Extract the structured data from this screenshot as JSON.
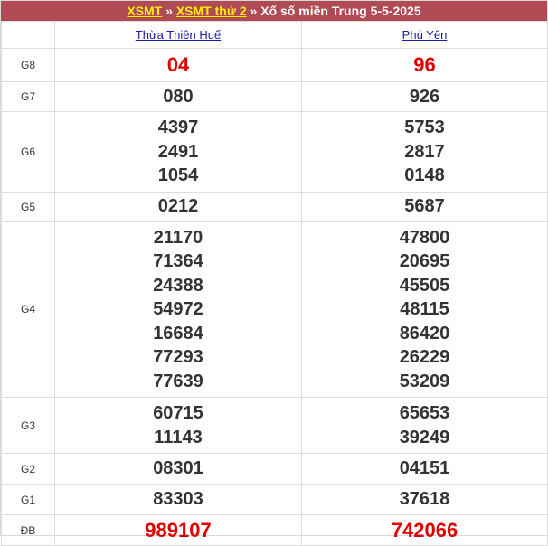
{
  "header": {
    "link1": "XSMT",
    "sep1": "»",
    "link2": "XSMT thứ 2",
    "sep2": "»",
    "title": "Xổ số miền Trung 5-5-2025"
  },
  "provinces": [
    "Thừa Thiên Huế",
    "Phú Yên"
  ],
  "prizes": [
    {
      "label": "G8",
      "p1": [
        "04"
      ],
      "p2": [
        "96"
      ]
    },
    {
      "label": "G7",
      "p1": [
        "080"
      ],
      "p2": [
        "926"
      ]
    },
    {
      "label": "G6",
      "p1": [
        "4397",
        "2491",
        "1054"
      ],
      "p2": [
        "5753",
        "2817",
        "0148"
      ]
    },
    {
      "label": "G5",
      "p1": [
        "0212"
      ],
      "p2": [
        "5687"
      ]
    },
    {
      "label": "G4",
      "p1": [
        "21170",
        "71364",
        "24388",
        "54972",
        "16684",
        "77293",
        "77639"
      ],
      "p2": [
        "47800",
        "20695",
        "45505",
        "48115",
        "86420",
        "26229",
        "53209"
      ]
    },
    {
      "label": "G3",
      "p1": [
        "60715",
        "11143"
      ],
      "p2": [
        "65653",
        "39249"
      ]
    },
    {
      "label": "G2",
      "p1": [
        "08301"
      ],
      "p2": [
        "04151"
      ]
    },
    {
      "label": "G1",
      "p1": [
        "83303"
      ],
      "p2": [
        "37618"
      ]
    },
    {
      "label": "ĐB",
      "p1": [
        "989107"
      ],
      "p2": [
        "742066"
      ]
    }
  ],
  "colors": {
    "header_bg": "#b04a55",
    "header_link": "#ffef00",
    "province_link": "#1a1aa6",
    "highlight_number": "#e00000"
  }
}
